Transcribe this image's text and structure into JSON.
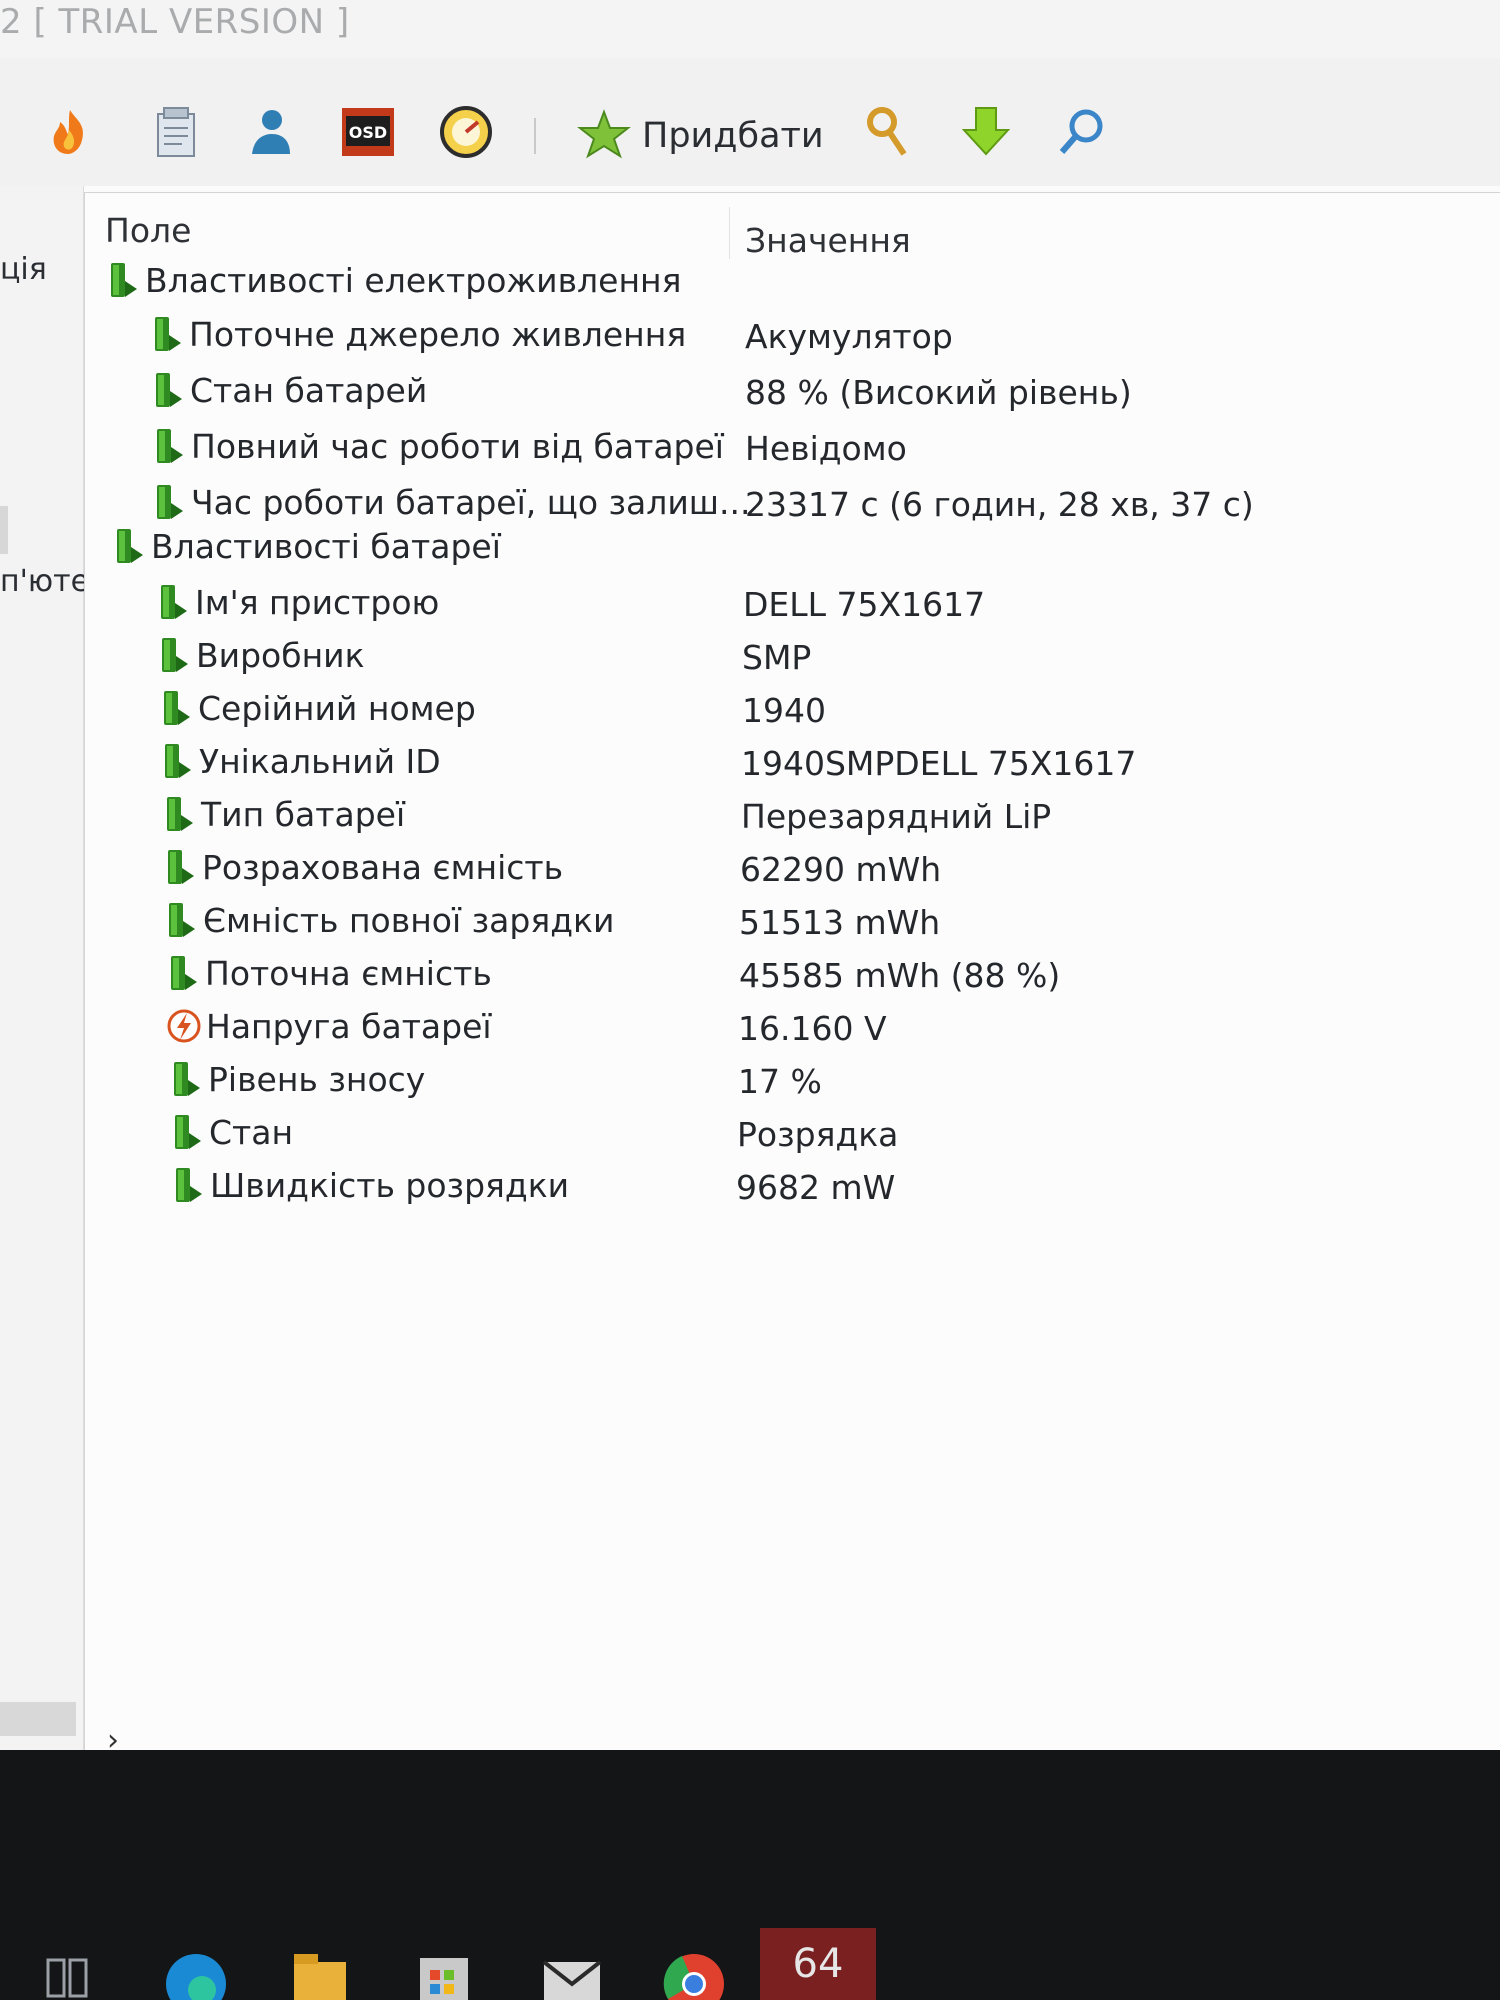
{
  "window": {
    "title": "2  [ TRIAL VERSION ]"
  },
  "toolbar": {
    "buy_label": "Придбати"
  },
  "left_pane": {
    "fragment_top": "ція",
    "fragment_mid": "п'юте"
  },
  "columns": {
    "field": "Поле",
    "value": "Значення"
  },
  "sections": [
    {
      "title": "Властивості електроживлення",
      "rows": [
        {
          "field": "Поточне джерело живлення",
          "value": "Акумулятор"
        },
        {
          "field": "Стан батарей",
          "value": "88 % (Високий рівень)"
        },
        {
          "field": "Повний час роботи від батареї",
          "value": "Невідомо"
        },
        {
          "field": "Час роботи батареї, що залиш...",
          "value": "23317 с (6 годин, 28 хв, 37 с)"
        }
      ]
    },
    {
      "title": "Властивості батареї",
      "rows": [
        {
          "field": "Ім'я пристрою",
          "value": "DELL 75X1617"
        },
        {
          "field": "Виробник",
          "value": "SMP"
        },
        {
          "field": "Серійний номер",
          "value": "1940"
        },
        {
          "field": "Унікальний ID",
          "value": "1940SMPDELL 75X1617"
        },
        {
          "field": "Тип батареї",
          "value": "Перезарядний LiP"
        },
        {
          "field": "Розрахована ємність",
          "value": "62290 mWh"
        },
        {
          "field": "Ємність повної зарядки",
          "value": "51513 mWh"
        },
        {
          "field": "Поточна ємність",
          "value": "45585 mWh  (88 %)"
        },
        {
          "field": "Напруга батареї",
          "value": "16.160 V",
          "icon": "voltage-icon"
        },
        {
          "field": "Рівень зносу",
          "value": "17 %"
        },
        {
          "field": "Стан",
          "value": "Розрядка"
        },
        {
          "field": "Швидкість розрядки",
          "value": "9682 mW"
        }
      ]
    }
  ],
  "taskbar": {
    "badge": "64"
  },
  "colors": {
    "battery_green": "#3a9a2a",
    "voltage_orange": "#d9531e",
    "text": "#24282c"
  }
}
